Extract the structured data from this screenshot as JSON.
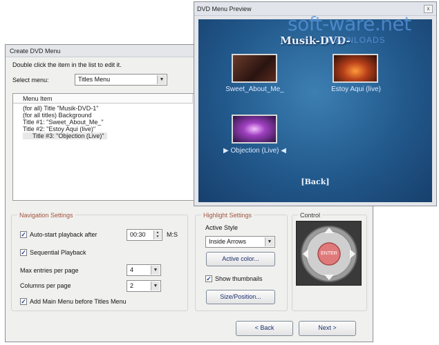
{
  "main_window": {
    "title": "Create DVD Menu",
    "instruction": "Double click the item in the list to edit it.",
    "select_menu_label": "Select menu:",
    "select_menu_value": "Titles Menu",
    "list_header": "Menu Item",
    "menu_items": [
      "(for all) Title \"Musik-DVD-1\"",
      "(for all titles) Background",
      "Title #1: \"Sweet_About_Me_\"",
      "Title #2: \"Estoy Aqui (live)\"",
      "Title #3: \"Objection (Live)\""
    ]
  },
  "navigation": {
    "title": "Navigation Settings",
    "autostart_label": "Auto-start playback after",
    "autostart_checked": true,
    "autostart_value": "00:30",
    "autostart_unit": "M:S",
    "sequential_label": "Sequential Playback",
    "sequential_checked": true,
    "max_entries_label": "Max entries per page",
    "max_entries_value": "4",
    "columns_label": "Columns per page",
    "columns_value": "2",
    "add_main_menu_label": "Add Main Menu before Titles Menu",
    "add_main_menu_checked": true
  },
  "highlight": {
    "title": "Highlight Settings",
    "active_style_label": "Active Style",
    "active_style_value": "Inside Arrows",
    "active_color_button": "Active color...",
    "show_thumbnails_label": "Show thumbnails",
    "show_thumbnails_checked": true,
    "size_position_button": "Size/Position..."
  },
  "control": {
    "title": "Control",
    "enter_label": "ENTER"
  },
  "footer": {
    "back_button": "< Back",
    "next_button": "Next >"
  },
  "preview_window": {
    "title": "DVD Menu Preview",
    "close_glyph": "x",
    "menu_title": "Musik-DVD-",
    "items": [
      {
        "caption": "Sweet_About_Me_"
      },
      {
        "caption": "Estoy Aqui (live)"
      },
      {
        "caption": "▶ Objection (Live) ◀"
      }
    ],
    "back_caption": "[Back]"
  },
  "watermark": {
    "text": "soft-ware.net",
    "subtext": "DOWNLOADS"
  },
  "colors": {
    "group_title": "#a0523d",
    "preview_bg": "#22598c",
    "enter_button": "#e07a7a"
  }
}
